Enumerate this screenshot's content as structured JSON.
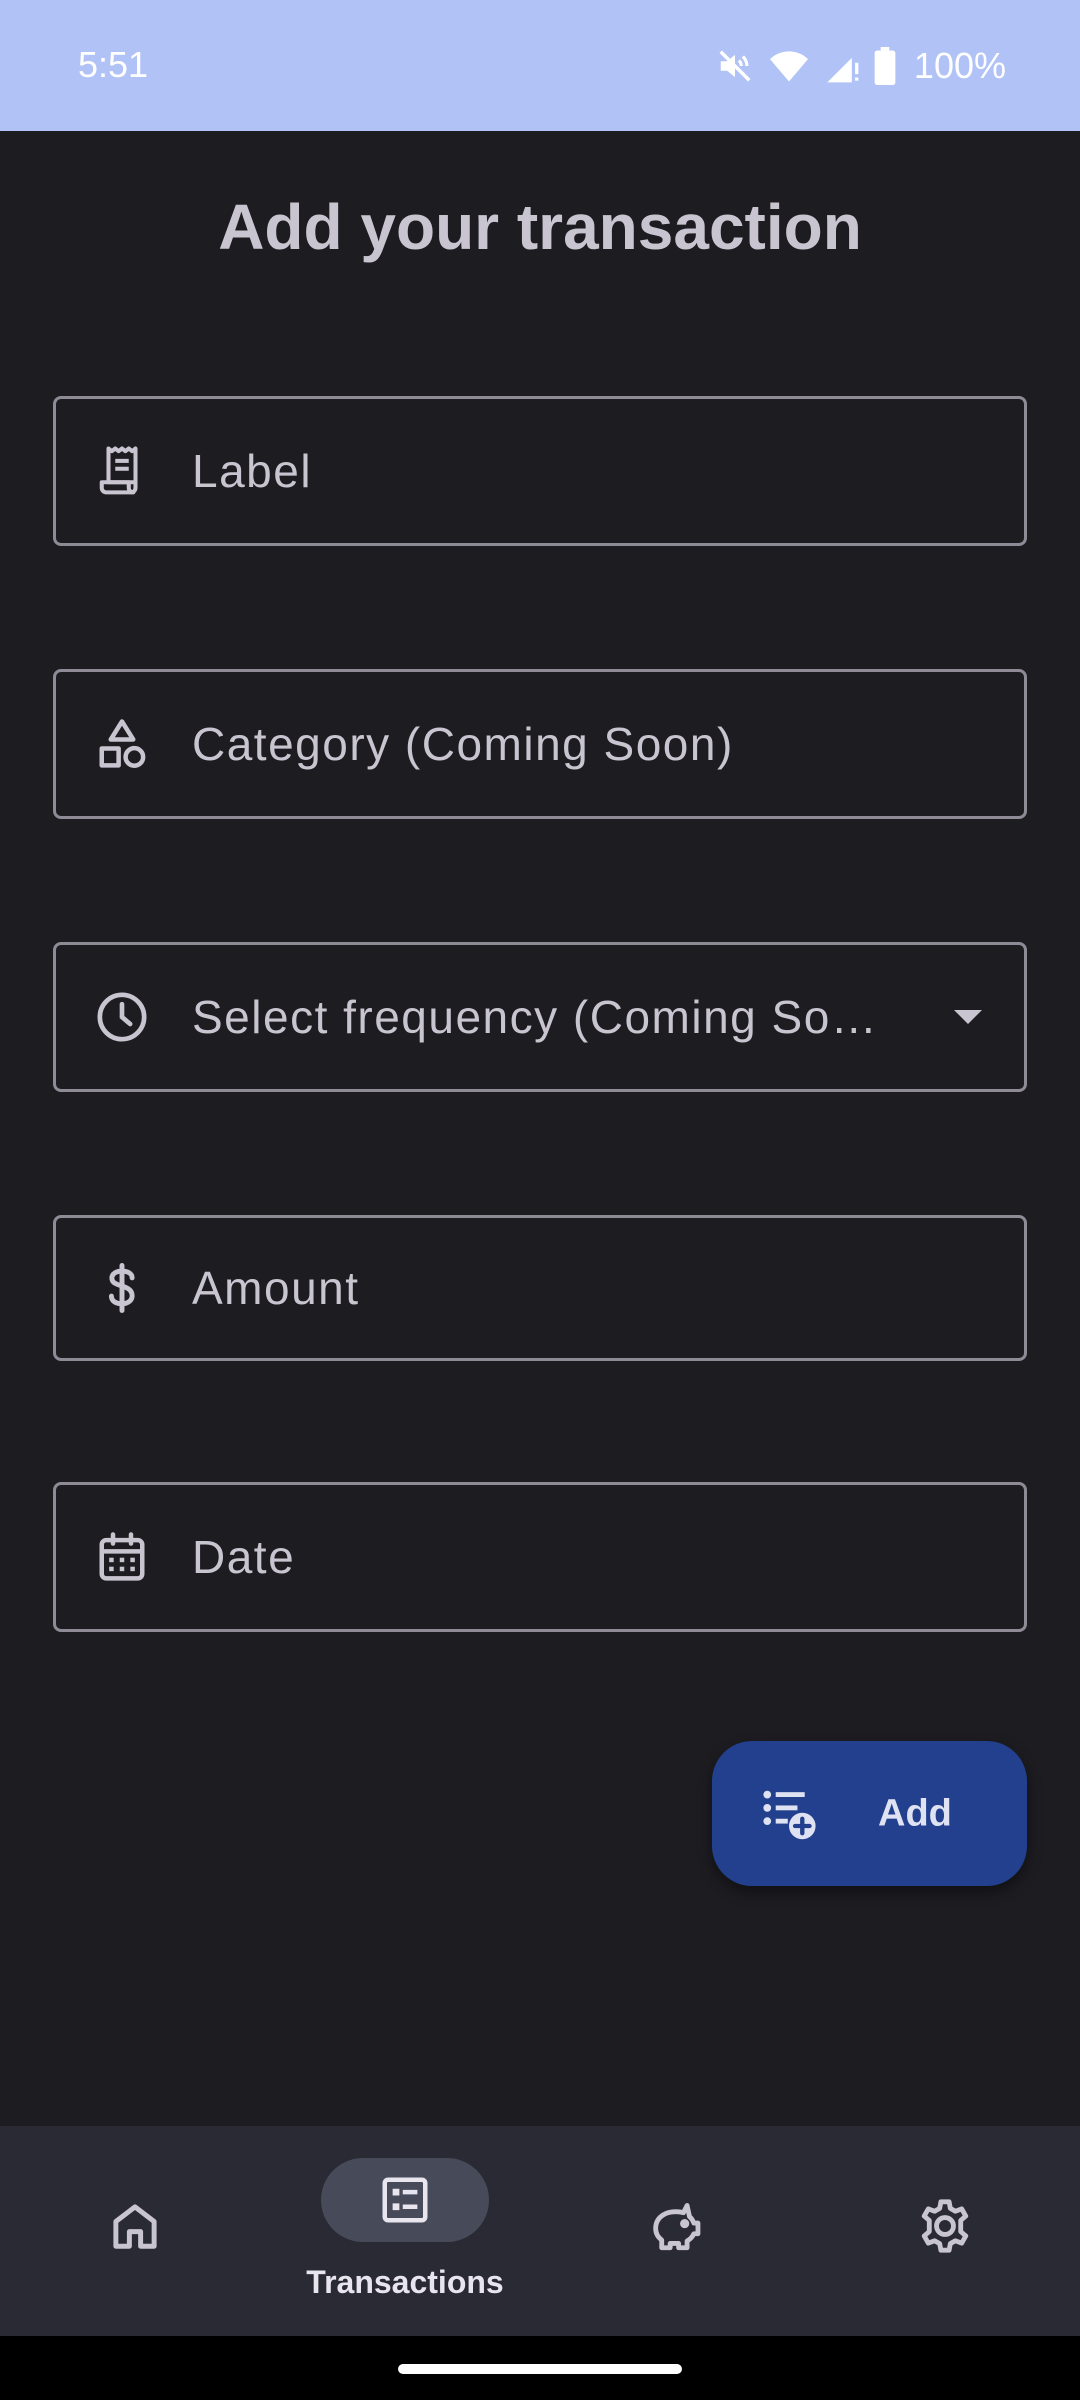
{
  "status_bar": {
    "time": "5:51",
    "battery": "100%",
    "icons": [
      "mute-icon",
      "wifi-icon",
      "signal-icon",
      "battery-icon"
    ],
    "background": "#b1c2f6"
  },
  "title": "Add your transaction",
  "fields": {
    "label": {
      "placeholder": "Label",
      "icon": "receipt-icon"
    },
    "category": {
      "placeholder": "Category (Coming Soon)",
      "icon": "shapes-icon"
    },
    "frequency": {
      "placeholder": "Select frequency (Coming So…",
      "icon": "clock-icon"
    },
    "amount": {
      "placeholder": "Amount",
      "icon": "dollar-icon"
    },
    "date": {
      "placeholder": "Date",
      "icon": "calendar-icon"
    }
  },
  "add_button": {
    "label": "Add",
    "icon": "playlist-add-icon",
    "color": "#22408d"
  },
  "bottom_nav": {
    "items": [
      {
        "label": "",
        "icon": "home-icon",
        "active": false
      },
      {
        "label": "Transactions",
        "icon": "list-alt-icon",
        "active": true
      },
      {
        "label": "",
        "icon": "savings-icon",
        "active": false
      },
      {
        "label": "",
        "icon": "settings-icon",
        "active": false
      }
    ]
  }
}
